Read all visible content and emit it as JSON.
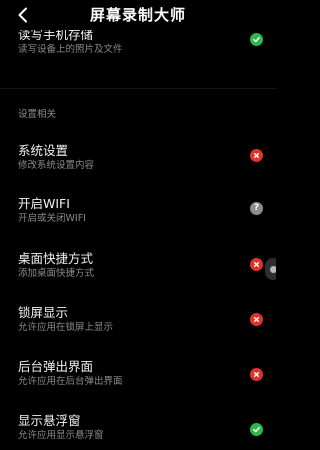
{
  "header": {
    "title": "屏幕录制大师"
  },
  "sections": {
    "settings_label": "设置相关"
  },
  "items": [
    {
      "title": "读写手机存储",
      "subtitle": "读写设备上的照片及文件",
      "status": "enabled"
    },
    {
      "title": "系统设置",
      "subtitle": "修改系统设置内容",
      "status": "disabled"
    },
    {
      "title": "开启WIFI",
      "subtitle": "开启或关闭WIFI",
      "status": "unknown"
    },
    {
      "title": "桌面快捷方式",
      "subtitle": "添加桌面快捷方式",
      "status": "disabled"
    },
    {
      "title": "锁屏显示",
      "subtitle": "允许应用在锁屏上显示",
      "status": "disabled"
    },
    {
      "title": "后台弹出界面",
      "subtitle": "允许应用在后台弹出界面",
      "status": "disabled"
    },
    {
      "title": "显示悬浮窗",
      "subtitle": "允许应用显示悬浮窗",
      "status": "enabled"
    }
  ],
  "icons": {
    "back": "chevron-left-icon",
    "enabled": "check-icon",
    "disabled": "close-icon",
    "unknown": "question-mark-icon"
  },
  "colors": {
    "background": "#000000",
    "enabled": "#2eb84b",
    "disabled": "#e0332a",
    "unknown": "#8c8c8c",
    "secondary_text": "#8a8a8a"
  },
  "unknown_glyph": "?"
}
